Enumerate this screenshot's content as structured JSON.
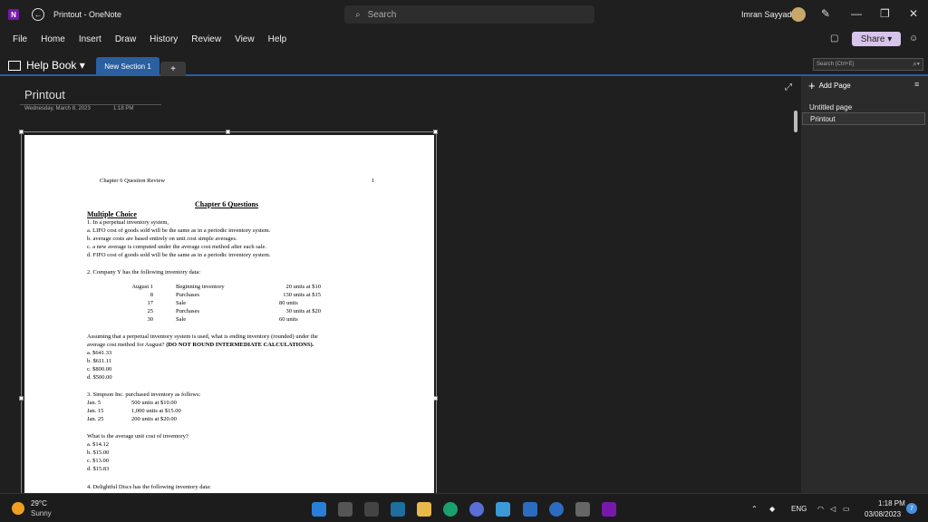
{
  "window": {
    "title": "Printout - OneNote",
    "app_icon": "N"
  },
  "search": {
    "placeholder": "Search"
  },
  "user": {
    "name": "Imran Sayyad"
  },
  "menu": [
    "File",
    "Home",
    "Insert",
    "Draw",
    "History",
    "Review",
    "View",
    "Help"
  ],
  "share": {
    "label": "Share"
  },
  "notebook": {
    "name": "Help Book"
  },
  "section": {
    "active_tab": "New Section 1",
    "add_label": "+"
  },
  "search_notes": {
    "placeholder": "Search (Ctrl+E)"
  },
  "page": {
    "title": "Printout",
    "date": "Wednesday, March 8, 2023",
    "time": "1:18 PM"
  },
  "document": {
    "header": "Chapter 6 Question Review",
    "page_number": "1",
    "chapter_title": "Chapter 6 Questions",
    "section_heading": "Multiple Choice",
    "q1": [
      "1.  In a perpetual inventory system,",
      "a.  LIFO cost of goods sold will be the same as in a periodic inventory system.",
      "b.  average costs are based entirely on unit cost simple averages.",
      "c.  a new average is computed under the average cost method after each sale.",
      "d.  FIFO cost of goods sold will be the same as in a periodic inventory system."
    ],
    "q2_intro": "2.  Company Y has the following inventory data:",
    "q2_table": [
      [
        "August 1",
        "Beginning inventory",
        "20 units at $10"
      ],
      [
        "8",
        "Purchases",
        "130 units at $15"
      ],
      [
        "17",
        "Sale",
        "80 units"
      ],
      [
        "25",
        "Purchases",
        "30 units at $20"
      ],
      [
        "30",
        "Sale",
        "60 units"
      ]
    ],
    "q2_text_1": "Assuming that a perpetual inventory system is used, what is ending inventory (rounded) under the",
    "q2_text_2": "average cost method for August? ",
    "q2_text_bold": "(DO NOT ROUND INTERMEDIATE CALCULATIONS).",
    "q2_options": [
      "a.   $641.33",
      "b.   $611.11",
      "c.   $800.00",
      "d.   $500.00"
    ],
    "q3_intro": "3.  Simpson Inc. purchased inventory as follows:",
    "q3_table": [
      [
        "Jan. 5",
        "500 units at $10.00"
      ],
      [
        "Jan. 15",
        "1,000 units at $15.00"
      ],
      [
        "Jan. 25",
        "200 units at $20.00"
      ]
    ],
    "q3_question": "What is the average unit cost of inventory?",
    "q3_options": [
      "a. $14.12",
      "b. $15.00",
      "c. $13.00",
      "d. $15.83"
    ],
    "q4_intro": "4.  Delightful Discs has the following inventory data:"
  },
  "sidepane": {
    "add_page_label": "Add Page",
    "pages": [
      "Untitled page",
      "Printout"
    ]
  },
  "taskbar": {
    "temperature": "29°C",
    "condition": "Sunny",
    "language": "ENG",
    "time": "1:18 PM",
    "date": "03/08/2023",
    "notification_count": "7"
  }
}
